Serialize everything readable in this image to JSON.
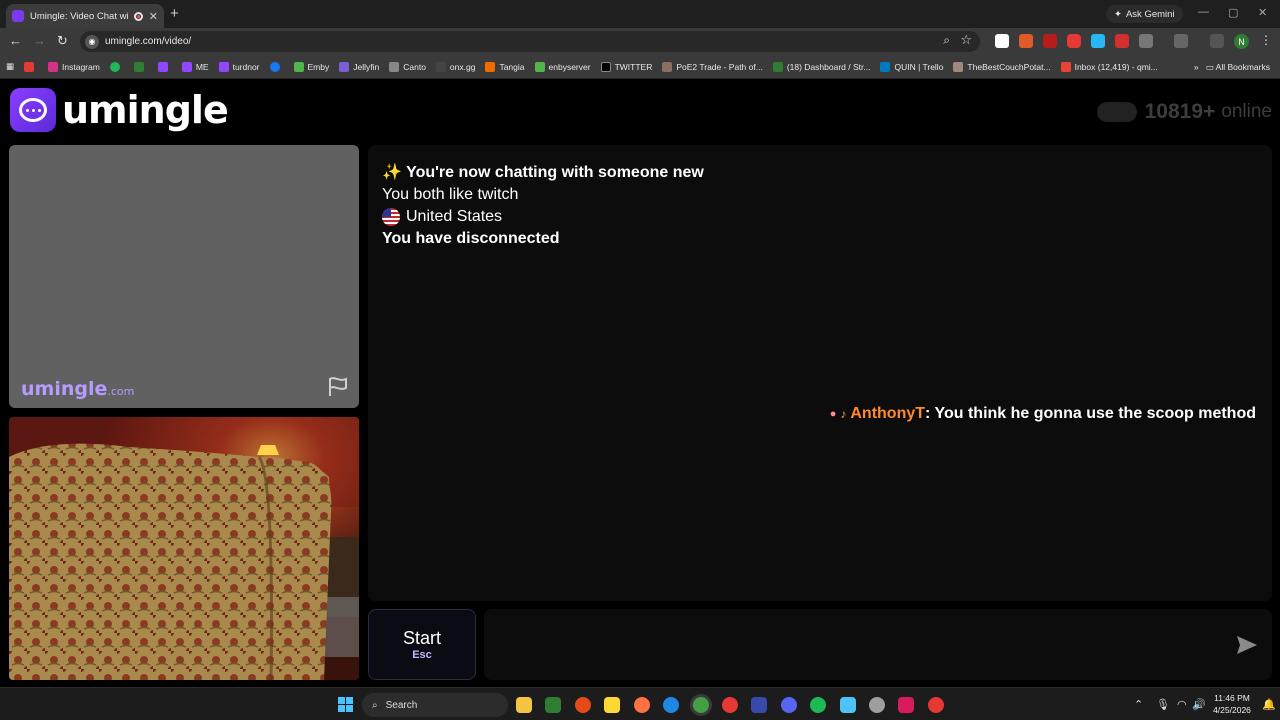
{
  "browser": {
    "tab_title": "Umingle: Video Chat with S",
    "close_tab": "✕",
    "new_tab": "+",
    "ask_gemini": "Ask Gemini",
    "url": "umingle.com/video/",
    "bookmarks": [
      "Instagram",
      "ME",
      "turdnor",
      "Emby",
      "Jellyfin",
      "Canto",
      "onx.gg",
      "Tangia",
      "enbyserver",
      "TWITTER",
      "PoE2 Trade - Path of...",
      "(18) Dashboard / Str...",
      "QUIN | Trello",
      "TheBestCouchPotat...",
      "Inbox (12,419) - qmi..."
    ],
    "all_bookmarks": "All Bookmarks",
    "profile_initial": "N",
    "accent": "#7c3aed"
  },
  "header": {
    "logo_text": "umingle",
    "online_count": "10819+",
    "online_label": "online"
  },
  "video": {
    "watermark": "umingle",
    "watermark_suffix": ".com"
  },
  "chat": {
    "spark": "✨",
    "status": "You're now chatting with someone new",
    "interest": "You both like twitch",
    "country": "United States",
    "disconnected": "You have disconnected",
    "overlay_user": "AnthonyT",
    "overlay_message": ": You think he gonna use the scoop method"
  },
  "controls": {
    "start_label": "Start",
    "start_hint": "Esc",
    "message_placeholder": ""
  },
  "taskbar": {
    "search_label": "Search",
    "time": "11:46 PM",
    "date": "4/25/2026"
  }
}
